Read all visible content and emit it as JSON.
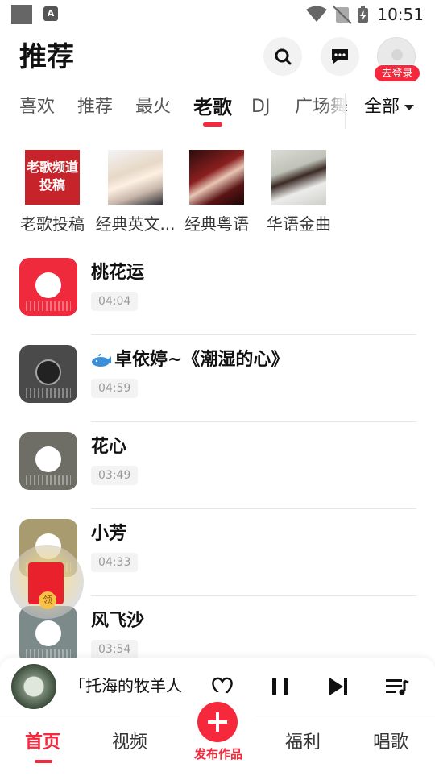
{
  "status_bar": {
    "time": "10:51",
    "app_icon_letter": "A"
  },
  "header": {
    "title": "推荐",
    "login_badge": "去登录"
  },
  "tabs": [
    {
      "label": "喜欢"
    },
    {
      "label": "推荐"
    },
    {
      "label": "最火"
    },
    {
      "label": "老歌",
      "active": true
    },
    {
      "label": "DJ"
    },
    {
      "label": "广场舞"
    }
  ],
  "all_tab": {
    "label": "全部"
  },
  "channels": [
    {
      "label": "老歌投稿",
      "thumb_text": "老歌频道投稿"
    },
    {
      "label": "经典英文..."
    },
    {
      "label": "经典粤语"
    },
    {
      "label": "华语金曲"
    }
  ],
  "songs": [
    {
      "title": "桃花运",
      "duration": "04:04",
      "cover_color": "#ee2a3c"
    },
    {
      "title": "卓依婷~《潮湿的心》",
      "duration": "04:59",
      "cover_color": "#4a4a4a"
    },
    {
      "title": "花心",
      "duration": "03:49",
      "cover_color": "#6e6e66"
    },
    {
      "title": "小芳",
      "duration": "04:33",
      "cover_color": "#a89b70"
    },
    {
      "title": "风飞沙",
      "duration": "03:54",
      "cover_color": "#7d8a8a"
    }
  ],
  "redpacket": {
    "seal_text": "领"
  },
  "player": {
    "title": "「托海的牧羊人"
  },
  "bottom_nav": {
    "home": "首页",
    "video": "视频",
    "publish": "发布作品",
    "welfare": "福利",
    "sing": "唱歌"
  },
  "colors": {
    "accent": "#f5283c"
  }
}
